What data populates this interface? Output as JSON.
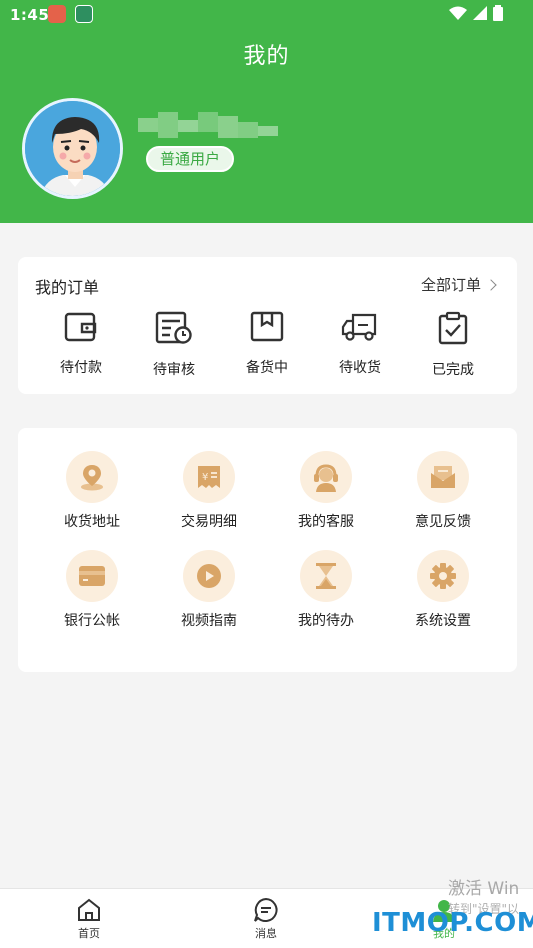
{
  "status_bar": {
    "time": "1:45"
  },
  "header": {
    "title": "我的"
  },
  "user": {
    "badge": "普通用户"
  },
  "orders": {
    "title": "我的订单",
    "all_label": "全部订单",
    "items": [
      {
        "label": "待付款",
        "icon": "wallet-icon"
      },
      {
        "label": "待审核",
        "icon": "review-clock-icon"
      },
      {
        "label": "备货中",
        "icon": "package-box-icon"
      },
      {
        "label": "待收货",
        "icon": "delivery-truck-icon"
      },
      {
        "label": "已完成",
        "icon": "clipboard-check-icon"
      }
    ]
  },
  "services": {
    "items": [
      {
        "label": "收货地址",
        "icon": "location-pin-icon"
      },
      {
        "label": "交易明细",
        "icon": "receipt-yen-icon"
      },
      {
        "label": "我的客服",
        "icon": "headset-agent-icon"
      },
      {
        "label": "意见反馈",
        "icon": "mail-feedback-icon"
      },
      {
        "label": "银行公帐",
        "icon": "bank-card-icon"
      },
      {
        "label": "视频指南",
        "icon": "play-circle-icon"
      },
      {
        "label": "我的待办",
        "icon": "hourglass-icon"
      },
      {
        "label": "系统设置",
        "icon": "gear-icon"
      }
    ]
  },
  "tabbar": {
    "items": [
      {
        "label": "首页",
        "icon": "home-icon"
      },
      {
        "label": "消息",
        "icon": "message-icon"
      },
      {
        "label": "我的",
        "icon": "profile-icon"
      }
    ]
  },
  "watermark": {
    "activate_title": "激活 Win",
    "activate_sub": "转到\"设置\"以",
    "site": "ITMOP.COM"
  },
  "colors": {
    "brand_green": "#42b649",
    "accent_peach": "#fbeedd",
    "icon_gold": "#d9a567"
  }
}
